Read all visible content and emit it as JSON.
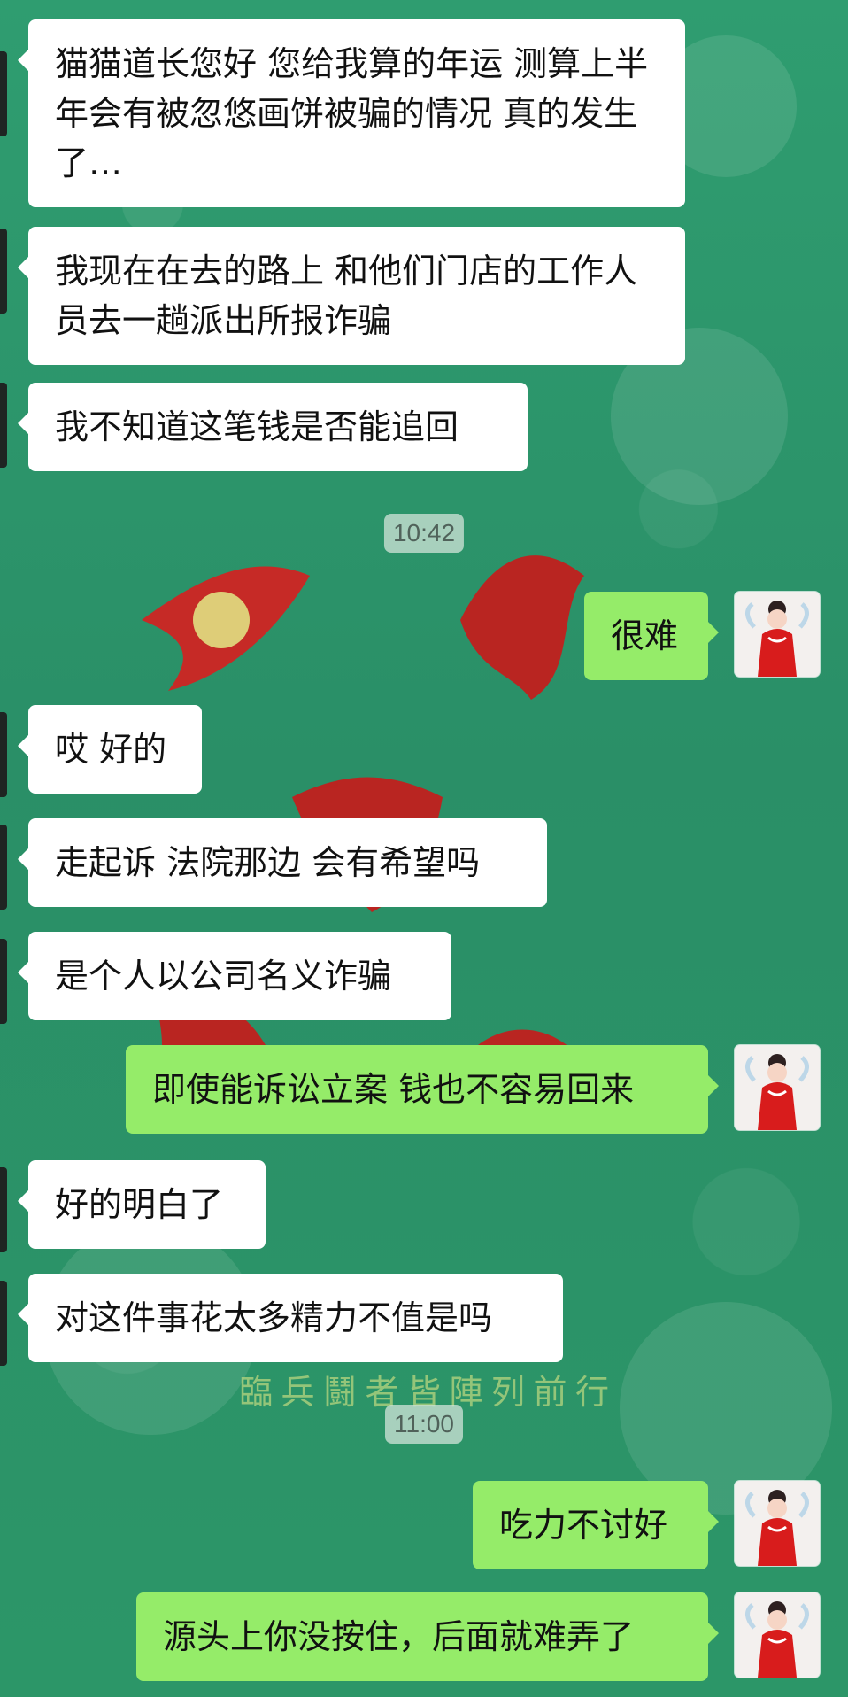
{
  "timestamps": [
    "10:42",
    "11:00"
  ],
  "watermark": {
    "line": "臨 兵 鬪 者 皆 陣 列 前 行"
  },
  "messages": [
    {
      "side": "left",
      "text": "猫猫道长您好 您给我算的年运 测算上半年会有被忽悠画饼被骗的情况 真的发生了…"
    },
    {
      "side": "left",
      "text": "我现在在去的路上 和他们门店的工作人员去一趟派出所报诈骗"
    },
    {
      "side": "left",
      "text": "我不知道这笔钱是否能追回"
    },
    {
      "side": "right",
      "text": "很难"
    },
    {
      "side": "left",
      "text": "哎 好的"
    },
    {
      "side": "left",
      "text": "走起诉 法院那边 会有希望吗"
    },
    {
      "side": "left",
      "text": "是个人以公司名义诈骗"
    },
    {
      "side": "right",
      "text": "即使能诉讼立案 钱也不容易回来"
    },
    {
      "side": "left",
      "text": "好的明白了"
    },
    {
      "side": "left",
      "text": "对这件事花太多精力不值是吗"
    },
    {
      "side": "right",
      "text": "吃力不讨好"
    },
    {
      "side": "right",
      "text": "源头上你没按住，后面就难弄了"
    }
  ],
  "colors": {
    "background": "#2f9a6c",
    "left_bubble": "#ffffff",
    "right_bubble": "#95ec69",
    "timestamp_bg": "#d2e4da",
    "accent_red": "#d71f1f"
  }
}
